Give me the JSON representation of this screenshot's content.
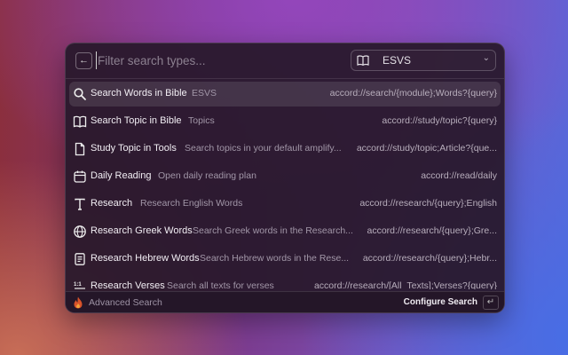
{
  "search": {
    "placeholder": "Filter search types...",
    "back_icon": "arrow-left-icon"
  },
  "module_select": {
    "value": "ESVS",
    "icon": "book-open-icon",
    "chevron": "chevron-down-icon"
  },
  "items": [
    {
      "icon": "search-icon",
      "name": "Search Words in Bible",
      "desc": "ESVS",
      "url": "accord://search/{module};Words?{query}",
      "selected": true
    },
    {
      "icon": "book-open-icon",
      "name": "Search Topic in Bible",
      "desc": "Topics",
      "url": "accord://study/topic?{query}"
    },
    {
      "icon": "file-icon",
      "name": "Study Topic in Tools",
      "desc": "Search topics in your default amplify...",
      "url": "accord://study/topic;Article?{que..."
    },
    {
      "icon": "calendar-icon",
      "name": "Daily Reading",
      "desc": "Open daily reading plan",
      "url": "accord://read/daily"
    },
    {
      "icon": "text-t-icon",
      "name": "Research",
      "desc": "Research English Words",
      "url": "accord://research/{query};English"
    },
    {
      "icon": "globe-icon",
      "name": "Research Greek Words",
      "desc": "Search Greek words in the Research...",
      "url": "accord://research/{query};Gre..."
    },
    {
      "icon": "document-icon",
      "name": "Research Hebrew Words",
      "desc": "Search Hebrew words in the Rese...",
      "url": "accord://research/{query};Hebr..."
    },
    {
      "icon": "verses-icon",
      "name": "Research Verses",
      "desc": "Search all texts for verses",
      "url": "accord://research/[All_Texts];Verses?{query}"
    }
  ],
  "footer": {
    "advanced_label": "Advanced Search",
    "configure_label": "Configure Search",
    "enter_key": "↵",
    "logo_icon": "flame-icon"
  }
}
